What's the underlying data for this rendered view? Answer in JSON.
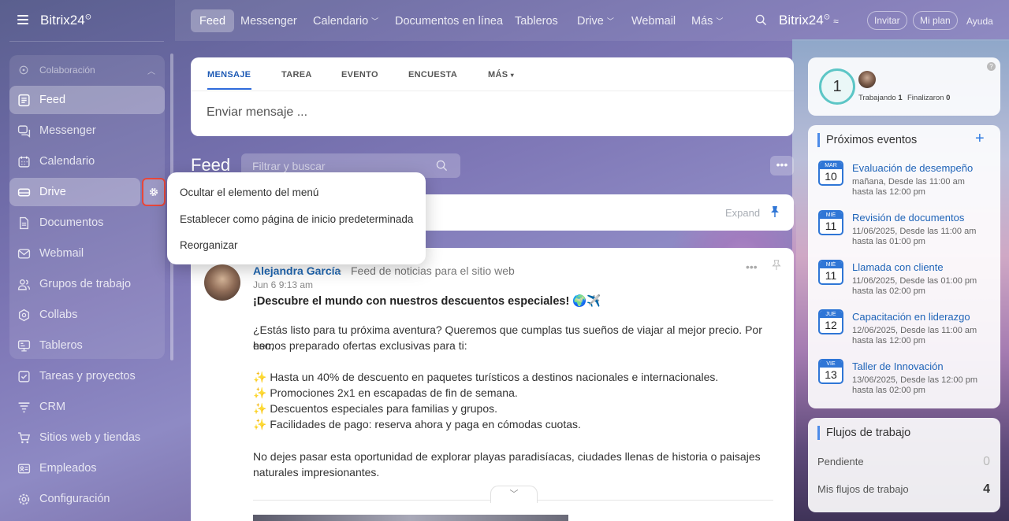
{
  "app": {
    "logo_text": "Bitrix24",
    "logo_mark": "⊙"
  },
  "sidebar": {
    "group_label": "Colaboración",
    "items": [
      {
        "label": "Feed",
        "icon": "feed-icon"
      },
      {
        "label": "Messenger",
        "icon": "chat-icon"
      },
      {
        "label": "Calendario",
        "icon": "calendar-icon"
      },
      {
        "label": "Drive",
        "icon": "drive-icon"
      },
      {
        "label": "Documentos",
        "icon": "document-icon"
      },
      {
        "label": "Webmail",
        "icon": "mail-icon"
      },
      {
        "label": "Grupos de trabajo",
        "icon": "group-icon"
      },
      {
        "label": "Collabs",
        "icon": "collab-icon"
      },
      {
        "label": "Tableros",
        "icon": "board-icon"
      },
      {
        "label": "Tareas y proyectos",
        "icon": "task-icon"
      },
      {
        "label": "CRM",
        "icon": "crm-icon"
      },
      {
        "label": "Sitios web y tiendas",
        "icon": "cart-icon"
      },
      {
        "label": "Empleados",
        "icon": "employees-icon"
      },
      {
        "label": "Configuración",
        "icon": "settings-icon"
      }
    ]
  },
  "topbar": {
    "nav": [
      "Feed",
      "Messenger",
      "Calendario",
      "Documentos en línea",
      "Tableros",
      "Drive",
      "Webmail",
      "Más"
    ],
    "invite": "Invitar",
    "plan": "Mi plan",
    "help": "Ayuda"
  },
  "composer": {
    "tabs": [
      "MENSAJE",
      "TAREA",
      "EVENTO",
      "ENCUESTA",
      "MÁS"
    ],
    "placeholder": "Enviar mensaje ..."
  },
  "feed": {
    "title": "Feed",
    "filter_placeholder": "Filtrar y buscar",
    "expand": "Expand"
  },
  "context_menu": {
    "items": [
      "Ocultar el elemento del menú",
      "Establecer como página de inicio predeterminada",
      "Reorganizar"
    ]
  },
  "post": {
    "author": "Alejandra García",
    "destination": "Feed de noticias para el sitio web",
    "date": "Jun 6 9:13 am",
    "title": "¡Descubre el mundo con nuestros descuentos especiales! 🌍✈️",
    "intro_1": "¿Estás listo para tu próxima aventura? Queremos que cumplas tus sueños de viajar al mejor precio. Por eso,",
    "intro_2": "hemos preparado ofertas exclusivas para ti:",
    "bullets": [
      "✨ Hasta un 40% de descuento en paquetes turísticos a destinos nacionales e internacionales.",
      "✨ Promociones 2x1 en escapadas de fin de semana.",
      "✨ Descuentos especiales para familias y grupos.",
      "✨ Facilidades de pago: reserva ahora y paga en cómodas cuotas."
    ],
    "outro_1": "No dejes pasar esta oportunidad de explorar playas paradisíacas, ciudades llenas de historia o paisajes",
    "outro_2": "naturales impresionantes."
  },
  "timeman": {
    "count": "1",
    "working_label": "Trabajando",
    "working_count": "1",
    "finished_label": "Finalizaron",
    "finished_count": "0"
  },
  "events": {
    "title": "Próximos eventos",
    "items": [
      {
        "month": "MAR",
        "day": "10",
        "title": "Evaluación de desempeño",
        "line1": "mañana, Desde las 11:00 am",
        "line2": "hasta las 12:00 pm"
      },
      {
        "month": "MIÉ",
        "day": "11",
        "title": "Revisión de documentos",
        "line1": "11/06/2025, Desde las 11:00 am",
        "line2": "hasta las 01:00 pm"
      },
      {
        "month": "MIÉ",
        "day": "11",
        "title": "Llamada con cliente",
        "line1": "11/06/2025, Desde las 01:00 pm",
        "line2": "hasta las 02:00 pm"
      },
      {
        "month": "JUE",
        "day": "12",
        "title": "Capacitación en liderazgo",
        "line1": "12/06/2025, Desde las 11:00 am",
        "line2": "hasta las 12:00 pm"
      },
      {
        "month": "VIE",
        "day": "13",
        "title": "Taller de Innovación",
        "line1": "13/06/2025, Desde las 12:00 pm",
        "line2": "hasta las 02:00 pm"
      }
    ]
  },
  "workflows": {
    "title": "Flujos de trabajo",
    "pending_label": "Pendiente",
    "pending_count": "0",
    "mine_label": "Mis flujos de trabajo",
    "mine_count": "4"
  },
  "colors": {
    "accent": "#2f76d6",
    "highlight_border": "#e8473a",
    "timeman_ring": "#5cc6c6"
  }
}
